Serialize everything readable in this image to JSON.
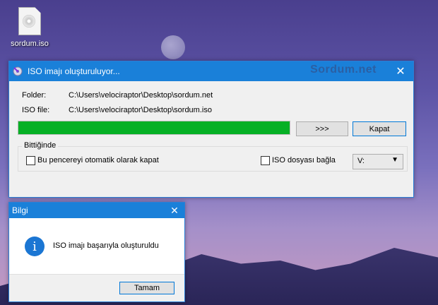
{
  "desktop": {
    "icon_label": "sordum.iso"
  },
  "main_window": {
    "title": "ISO imajı oluşturuluyor...",
    "brand": "Sordum.net",
    "folder_label": "Folder:",
    "folder_value": "C:\\Users\\velociraptor\\Desktop\\sordum.net",
    "iso_label": "ISO file:",
    "iso_value": "C:\\Users\\velociraptor\\Desktop\\sordum.iso",
    "progress_percent": 100,
    "progress_color": "#06b025",
    "more_button": ">>>",
    "close_button": "Kapat",
    "group_title": "Bittiğinde",
    "auto_close_label": "Bu pencereyi otomatik olarak kapat",
    "auto_close_checked": false,
    "mount_label": "ISO dosyası bağla",
    "mount_checked": false,
    "drive_value": "V:"
  },
  "info_dialog": {
    "title": "Bilgi",
    "message": "ISO imajı başarıyla oluşturuldu",
    "ok_button": "Tamam",
    "icon": "info-icon"
  },
  "colors": {
    "titlebar": "#1a80d9",
    "accent": "#0078d7"
  }
}
